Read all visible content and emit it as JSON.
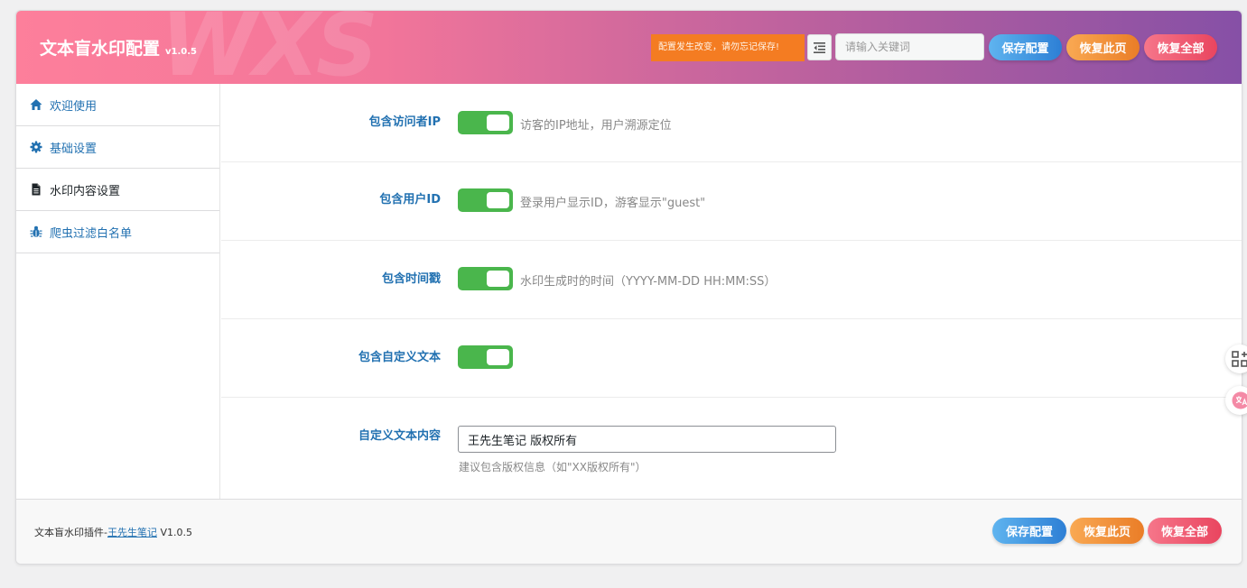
{
  "header": {
    "title": "文本盲水印配置",
    "version": "v1.0.5",
    "decoration": "WXS",
    "notice": "配置发生改变，请勿忘记保存!",
    "search_placeholder": "请输入关键词",
    "save_label": "保存配置",
    "restore_page_label": "恢复此页",
    "restore_all_label": "恢复全部"
  },
  "sidebar": {
    "items": [
      {
        "label": "欢迎使用",
        "icon": "home-icon",
        "active": false
      },
      {
        "label": "基础设置",
        "icon": "gear-icon",
        "active": false
      },
      {
        "label": "水印内容设置",
        "icon": "document-icon",
        "active": true
      },
      {
        "label": "爬虫过滤白名单",
        "icon": "bug-icon",
        "active": false
      }
    ]
  },
  "settings": [
    {
      "label": "包含访问者IP",
      "enabled": true,
      "desc": "访客的IP地址，用户溯源定位"
    },
    {
      "label": "包含用户ID",
      "enabled": true,
      "desc": "登录用户显示ID，游客显示\"guest\""
    },
    {
      "label": "包含时间戳",
      "enabled": true,
      "desc": "水印生成时的时间（YYYY-MM-DD HH:MM:SS）"
    },
    {
      "label": "包含自定义文本",
      "enabled": true,
      "desc": ""
    }
  ],
  "custom_text": {
    "label": "自定义文本内容",
    "value": "王先生笔记 版权所有",
    "hint": "建议包含版权信息（如\"XX版权所有\"）"
  },
  "footer": {
    "prefix": "文本盲水印插件-",
    "link": "王先生笔记",
    "version": "V1.0.5",
    "save_label": "保存配置",
    "restore_page_label": "恢复此页",
    "restore_all_label": "恢复全部"
  },
  "colors": {
    "header_start": "#fd7f9b",
    "header_end": "#8650a6",
    "toggle_on": "#4ab64c",
    "label_blue": "#2271b1",
    "notice_orange": "#f47c22"
  }
}
